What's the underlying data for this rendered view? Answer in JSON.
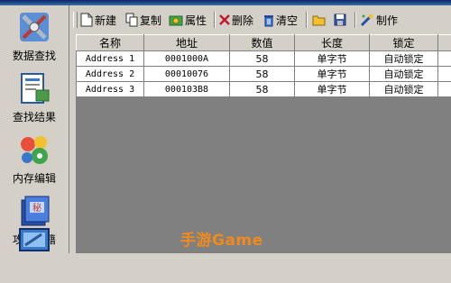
{
  "sidebar": {
    "items": [
      {
        "label": "数据查找",
        "icon": "search-tools-icon"
      },
      {
        "label": "查找结果",
        "icon": "results-document-icon"
      },
      {
        "label": "内存编辑",
        "icon": "memory-edit-icon"
      },
      {
        "label": "攻略秘籍",
        "icon": "guide-book-icon"
      },
      {
        "label": "",
        "icon": "computer-icon"
      }
    ]
  },
  "toolbar": {
    "new_label": "新建",
    "copy_label": "复制",
    "props_label": "属性",
    "delete_label": "删除",
    "clear_label": "清空",
    "make_label": "制作"
  },
  "table": {
    "columns": [
      "名称",
      "地址",
      "数值",
      "长度",
      "锁定"
    ],
    "rows": [
      [
        "Address 1",
        "0001000A",
        "58",
        "单字节",
        "自动锁定"
      ],
      [
        "Address 2",
        "00010076",
        "58",
        "单字节",
        "自动锁定"
      ],
      [
        "Address 3",
        "000103B8",
        "58",
        "单字节",
        "自动锁定"
      ]
    ]
  },
  "watermark": "手游Game"
}
